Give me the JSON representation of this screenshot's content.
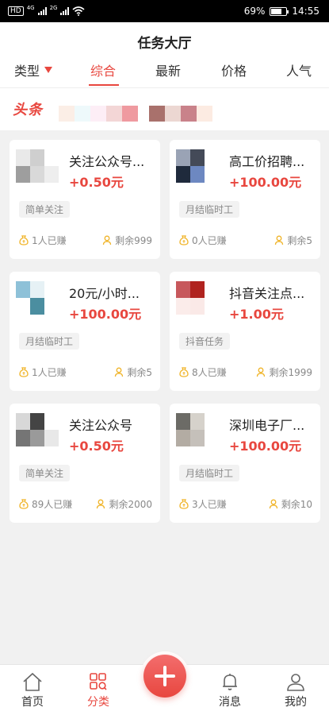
{
  "status_bar": {
    "battery": "69%",
    "time": "14:55",
    "chip": "HD",
    "net1": "4G",
    "net2": "2G"
  },
  "header": {
    "title": "任务大厅",
    "tabs": [
      {
        "label": "类型",
        "has_dropdown": true
      },
      {
        "label": "综合",
        "active": true
      },
      {
        "label": "最新"
      },
      {
        "label": "价格"
      },
      {
        "label": "人气"
      }
    ]
  },
  "banner": {
    "tag": "头条",
    "tiles": [
      "#fbeee6",
      "#eef9fb",
      "#fdeef6",
      "#f3d6d6",
      "#ef9aa0",
      "#ffffff",
      "#a9716c",
      "#ecd7d2",
      "#c9828a",
      "#fcebe2"
    ]
  },
  "tasks": [
    {
      "title": "关注公众号...",
      "price": "+0.50元",
      "tag": "简单关注",
      "earned": "1人已赚",
      "remaining": "剩余999",
      "thumb": [
        "#e9e9e9",
        "#cfcfcf",
        "#ffffff",
        "#9e9e9e",
        "#d9d9d9",
        "#eeeeee"
      ]
    },
    {
      "title": "高工价招聘...",
      "price": "+100.00元",
      "tag": "月结临时工",
      "earned": "0人已赚",
      "remaining": "剩余5",
      "thumb": [
        "#9aa3b5",
        "#444a58",
        "#ffffff",
        "#1f2a3c",
        "#6d88c1",
        "#ffffff"
      ]
    },
    {
      "title": "20元/小时...",
      "price": "+100.00元",
      "tag": "月结临时工",
      "earned": "1人已赚",
      "remaining": "剩余5",
      "thumb": [
        "#8ec1d8",
        "#e6f1f5",
        "#ffffff",
        "#ffffff",
        "#4b8ea0",
        "#ffffff"
      ]
    },
    {
      "title": "抖音关注点...",
      "price": "+1.00元",
      "tag": "抖音任务",
      "earned": "8人已赚",
      "remaining": "剩余1999",
      "thumb": [
        "#c7585c",
        "#b0231f",
        "#ffffff",
        "#fbecea",
        "#fae9e7",
        "#ffffff"
      ]
    },
    {
      "title": "关注公众号",
      "price": "+0.50元",
      "tag": "简单关注",
      "earned": "89人已赚",
      "remaining": "剩余2000",
      "thumb": [
        "#d8d8d8",
        "#444444",
        "#ffffff",
        "#757575",
        "#9a9a9a",
        "#e8e8e8"
      ]
    },
    {
      "title": "深圳电子厂...",
      "price": "+100.00元",
      "tag": "月结临时工",
      "earned": "3人已赚",
      "remaining": "剩余10",
      "thumb": [
        "#6c6b66",
        "#d6d2cb",
        "#ffffff",
        "#b3aca3",
        "#c5c0ba",
        "#ffffff"
      ]
    }
  ],
  "bottom_nav": [
    {
      "label": "首页",
      "icon": "home-icon"
    },
    {
      "label": "分类",
      "icon": "grid-icon",
      "active": true
    },
    {
      "label": "消息",
      "icon": "bell-icon"
    },
    {
      "label": "我的",
      "icon": "profile-icon"
    }
  ],
  "fab": {
    "icon": "plus-icon"
  },
  "colors": {
    "accent": "#e8473f",
    "icon_gold": "#f0b429"
  }
}
